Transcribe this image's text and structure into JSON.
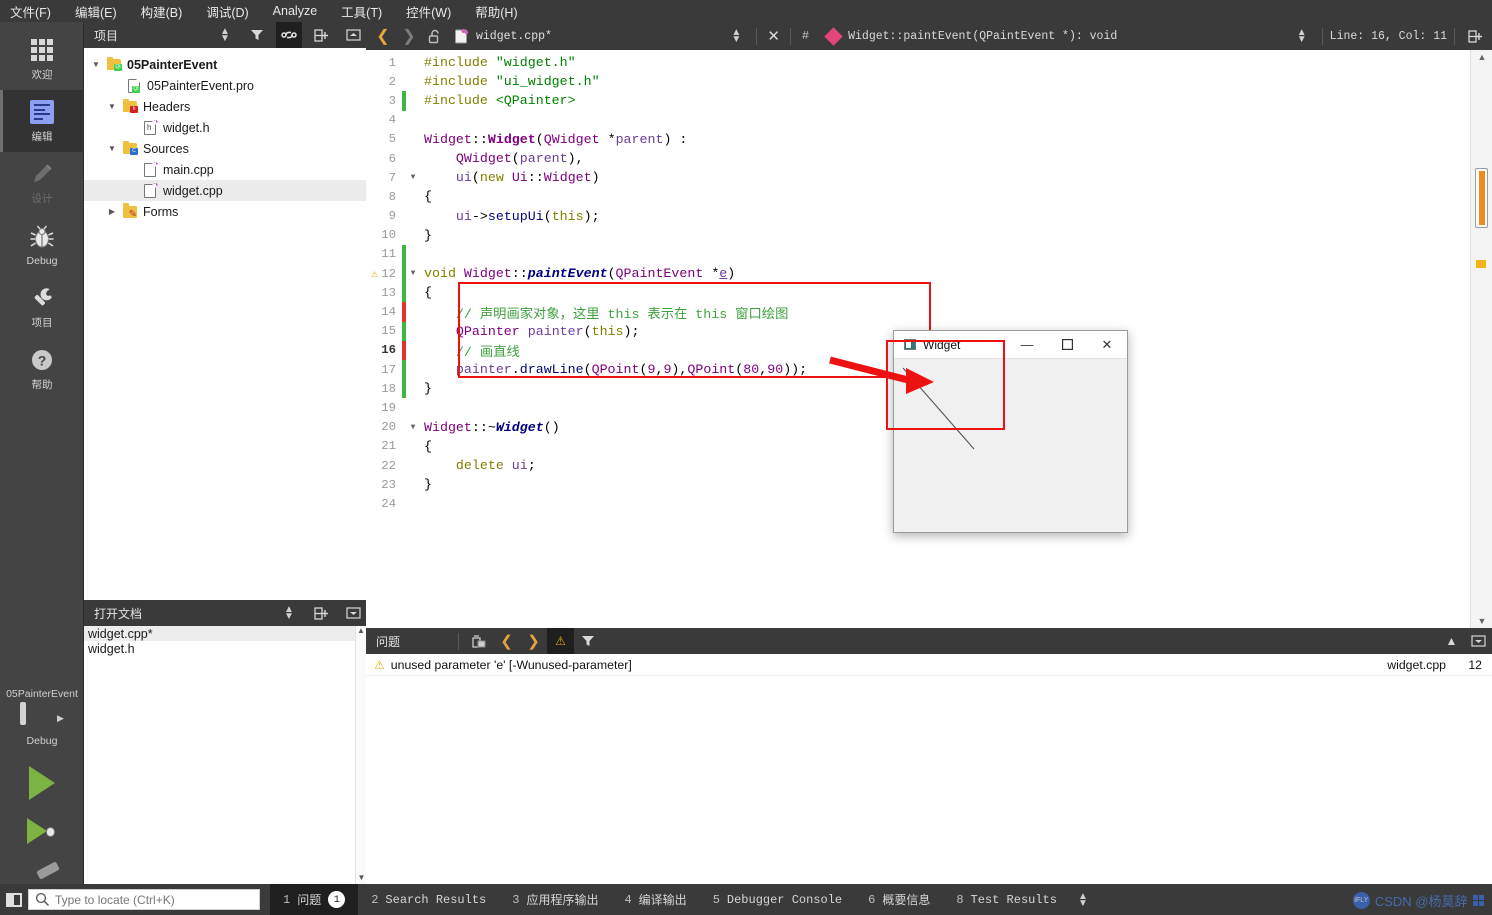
{
  "menubar": [
    {
      "label": "文件(F)",
      "accel": "F"
    },
    {
      "label": "编辑(E)",
      "accel": "E"
    },
    {
      "label": "构建(B)",
      "accel": "B"
    },
    {
      "label": "调试(D)",
      "accel": "D"
    },
    {
      "label": "Analyze",
      "accel": "A"
    },
    {
      "label": "工具(T)",
      "accel": "T"
    },
    {
      "label": "控件(W)",
      "accel": "W"
    },
    {
      "label": "帮助(H)",
      "accel": "H"
    }
  ],
  "modebar": {
    "items": [
      {
        "label": "欢迎",
        "icon": "grid-icon",
        "state": "normal"
      },
      {
        "label": "编辑",
        "icon": "edit-icon",
        "state": "selected"
      },
      {
        "label": "设计",
        "icon": "pencil-icon",
        "state": "disabled"
      },
      {
        "label": "Debug",
        "icon": "bug-icon",
        "state": "normal"
      },
      {
        "label": "项目",
        "icon": "wrench-icon",
        "state": "normal"
      },
      {
        "label": "帮助",
        "icon": "question-icon",
        "state": "normal"
      }
    ],
    "kit": {
      "project": "05PainterEvent",
      "build_config": "Debug",
      "run_label": "Run",
      "debug_label": "Start Debugging",
      "build_label": "Build"
    }
  },
  "project_panel": {
    "title": "项目",
    "tree": [
      {
        "label": "05PainterEvent",
        "depth": 0,
        "icon": "qt-folder-icon",
        "twist": "open",
        "bold": true,
        "selected": false
      },
      {
        "label": "05PainterEvent.pro",
        "depth": 1,
        "icon": "qt-pro-file-icon",
        "twist": "none",
        "bold": false,
        "selected": false
      },
      {
        "label": "Headers",
        "depth": 1,
        "icon": "headers-folder-icon",
        "twist": "open",
        "bold": false,
        "selected": false
      },
      {
        "label": "widget.h",
        "depth": 2,
        "icon": "h-file-icon",
        "twist": "none",
        "bold": false,
        "selected": false
      },
      {
        "label": "Sources",
        "depth": 1,
        "icon": "sources-folder-icon",
        "twist": "open",
        "bold": false,
        "selected": false
      },
      {
        "label": "main.cpp",
        "depth": 2,
        "icon": "cpp-file-icon",
        "twist": "none",
        "bold": false,
        "selected": false
      },
      {
        "label": "widget.cpp",
        "depth": 2,
        "icon": "cpp-file-icon",
        "twist": "none",
        "bold": false,
        "selected": true
      },
      {
        "label": "Forms",
        "depth": 1,
        "icon": "forms-folder-icon",
        "twist": "closed",
        "bold": false,
        "selected": false
      }
    ]
  },
  "open_documents": {
    "title": "打开文档",
    "items": [
      {
        "label": "widget.cpp*",
        "selected": true
      },
      {
        "label": "widget.h",
        "selected": false
      }
    ]
  },
  "editor": {
    "filename": "widget.cpp*",
    "symbol": "Widget::paintEvent(QPaintEvent *): void",
    "line_col": "Line: 16, Col: 11",
    "hash_label": "#",
    "lines": [
      {
        "no": "1",
        "bar": "none",
        "fold": "",
        "warn": false,
        "current": false
      },
      {
        "no": "2",
        "bar": "none",
        "fold": "",
        "warn": false,
        "current": false
      },
      {
        "no": "3",
        "bar": "green",
        "fold": "",
        "warn": false,
        "current": false
      },
      {
        "no": "4",
        "bar": "none",
        "fold": "",
        "warn": false,
        "current": false
      },
      {
        "no": "5",
        "bar": "none",
        "fold": "",
        "warn": false,
        "current": false
      },
      {
        "no": "6",
        "bar": "none",
        "fold": "",
        "warn": false,
        "current": false
      },
      {
        "no": "7",
        "bar": "none",
        "fold": "open",
        "warn": false,
        "current": false
      },
      {
        "no": "8",
        "bar": "none",
        "fold": "",
        "warn": false,
        "current": false
      },
      {
        "no": "9",
        "bar": "none",
        "fold": "",
        "warn": false,
        "current": false
      },
      {
        "no": "10",
        "bar": "none",
        "fold": "",
        "warn": false,
        "current": false
      },
      {
        "no": "11",
        "bar": "green",
        "fold": "",
        "warn": false,
        "current": false
      },
      {
        "no": "12",
        "bar": "green",
        "fold": "open",
        "warn": true,
        "current": false
      },
      {
        "no": "13",
        "bar": "green",
        "fold": "",
        "warn": false,
        "current": false
      },
      {
        "no": "14",
        "bar": "red",
        "fold": "",
        "warn": false,
        "current": false
      },
      {
        "no": "15",
        "bar": "green",
        "fold": "",
        "warn": false,
        "current": false
      },
      {
        "no": "16",
        "bar": "red",
        "fold": "",
        "warn": false,
        "current": true
      },
      {
        "no": "17",
        "bar": "green",
        "fold": "",
        "warn": false,
        "current": false
      },
      {
        "no": "18",
        "bar": "green",
        "fold": "",
        "warn": false,
        "current": false
      },
      {
        "no": "19",
        "bar": "none",
        "fold": "",
        "warn": false,
        "current": false
      },
      {
        "no": "20",
        "bar": "none",
        "fold": "open",
        "warn": false,
        "current": false
      },
      {
        "no": "21",
        "bar": "none",
        "fold": "",
        "warn": false,
        "current": false
      },
      {
        "no": "22",
        "bar": "none",
        "fold": "",
        "warn": false,
        "current": false
      },
      {
        "no": "23",
        "bar": "none",
        "fold": "",
        "warn": false,
        "current": false
      },
      {
        "no": "24",
        "bar": "none",
        "fold": "",
        "warn": false,
        "current": false
      }
    ],
    "source_text": [
      "#include \"widget.h\"",
      "#include \"ui_widget.h\"",
      "#include <QPainter>",
      "",
      "Widget::Widget(QWidget *parent) :",
      "    QWidget(parent),",
      "    ui(new Ui::Widget)",
      "{",
      "    ui->setupUi(this);",
      "}",
      "",
      "void Widget::paintEvent(QPaintEvent *e)",
      "{",
      "    // 声明画家对象，这里 this 表示在 this 窗口绘图",
      "    QPainter painter(this);",
      "    // 画直线",
      "    painter.drawLine(QPoint(9,9),QPoint(80,90));",
      "}",
      "",
      "Widget::~Widget()",
      "{",
      "    delete ui;",
      "}",
      ""
    ]
  },
  "issues_panel": {
    "title": "问题",
    "rows": [
      {
        "severity": "warning",
        "message": "unused parameter 'e' [-Wunused-parameter]",
        "file": "widget.cpp",
        "line": "12"
      }
    ]
  },
  "statusbar": {
    "locator_placeholder": "Type to locate (Ctrl+K)",
    "tabs": [
      {
        "num": "1",
        "label": "问题",
        "badge": "1",
        "active": true
      },
      {
        "num": "2",
        "label": "Search Results",
        "badge": "",
        "active": false
      },
      {
        "num": "3",
        "label": "应用程序输出",
        "badge": "",
        "active": false
      },
      {
        "num": "4",
        "label": "编译输出",
        "badge": "",
        "active": false
      },
      {
        "num": "5",
        "label": "Debugger Console",
        "badge": "",
        "active": false
      },
      {
        "num": "6",
        "label": "概要信息",
        "badge": "",
        "active": false
      },
      {
        "num": "8",
        "label": "Test Results",
        "badge": "",
        "active": false
      }
    ]
  },
  "qt_window": {
    "title": "Widget",
    "minimize": "—",
    "maximize": "▢",
    "close": "✕",
    "drawing": "diagonal line from QPoint(9,9) to QPoint(80,90)"
  },
  "watermark": {
    "text": "CSDN @杨莫辞"
  },
  "colors": {
    "accent_orange": "#e8a33d",
    "warning_yellow": "#e8b114",
    "annotation_red": "#ee1111",
    "change_green": "#3fb63f",
    "change_red": "#e03030",
    "chrome_dark": "#3a3a3a",
    "mode_bg": "#444444"
  }
}
